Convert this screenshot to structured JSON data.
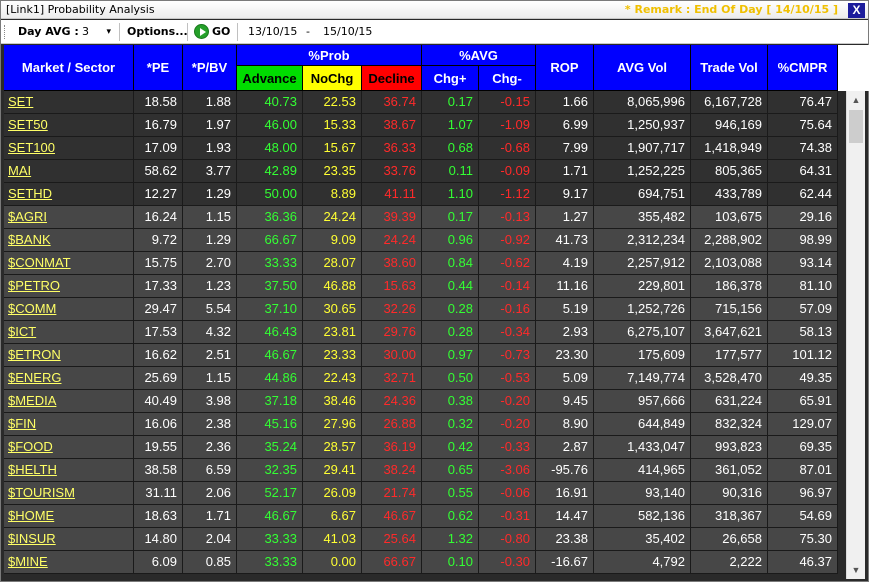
{
  "window": {
    "title": "[Link1] Probability Analysis",
    "remark": "* Remark : End Of Day [ 14/10/15 ]",
    "close": "X"
  },
  "toolbar": {
    "day_avg_label": "Day AVG :",
    "day_avg_value": "3",
    "options_label": "Options...",
    "go_label": "GO",
    "date_from": "13/10/15",
    "date_sep": "-",
    "date_to": "15/10/15"
  },
  "header": {
    "market": "Market / Sector",
    "pe": "*PE",
    "pbv": "*P/BV",
    "prob": "%Prob",
    "advance": "Advance",
    "nochg": "NoChg",
    "decline": "Decline",
    "avg": "%AVG",
    "chg_plus": "Chg+",
    "chg_minus": "Chg-",
    "rop": "ROP",
    "avg_vol": "AVG Vol",
    "trade_vol": "Trade Vol",
    "cmpr": "%CMPR"
  },
  "rows": [
    {
      "name": "SET",
      "pe": "18.58",
      "pbv": "1.88",
      "adv": "40.73",
      "noc": "22.53",
      "dec": "36.74",
      "chgp": "0.17",
      "chgm": "-0.15",
      "rop": "1.66",
      "avgvol": "8,065,996",
      "tradevol": "6,167,728",
      "cmpr": "76.47",
      "kind": "index"
    },
    {
      "name": "SET50",
      "pe": "16.79",
      "pbv": "1.97",
      "adv": "46.00",
      "noc": "15.33",
      "dec": "38.67",
      "chgp": "1.07",
      "chgm": "-1.09",
      "rop": "6.99",
      "avgvol": "1,250,937",
      "tradevol": "946,169",
      "cmpr": "75.64",
      "kind": "index"
    },
    {
      "name": "SET100",
      "pe": "17.09",
      "pbv": "1.93",
      "adv": "48.00",
      "noc": "15.67",
      "dec": "36.33",
      "chgp": "0.68",
      "chgm": "-0.68",
      "rop": "7.99",
      "avgvol": "1,907,717",
      "tradevol": "1,418,949",
      "cmpr": "74.38",
      "kind": "index"
    },
    {
      "name": "MAI",
      "pe": "58.62",
      "pbv": "3.77",
      "adv": "42.89",
      "noc": "23.35",
      "dec": "33.76",
      "chgp": "0.11",
      "chgm": "-0.09",
      "rop": "1.71",
      "avgvol": "1,252,225",
      "tradevol": "805,365",
      "cmpr": "64.31",
      "kind": "index"
    },
    {
      "name": "SETHD",
      "pe": "12.27",
      "pbv": "1.29",
      "adv": "50.00",
      "noc": "8.89",
      "dec": "41.11",
      "chgp": "1.10",
      "chgm": "-1.12",
      "rop": "9.17",
      "avgvol": "694,751",
      "tradevol": "433,789",
      "cmpr": "62.44",
      "kind": "index"
    },
    {
      "name": "$AGRI",
      "pe": "16.24",
      "pbv": "1.15",
      "adv": "36.36",
      "noc": "24.24",
      "dec": "39.39",
      "chgp": "0.17",
      "chgm": "-0.13",
      "rop": "1.27",
      "avgvol": "355,482",
      "tradevol": "103,675",
      "cmpr": "29.16",
      "kind": "sector"
    },
    {
      "name": "$BANK",
      "pe": "9.72",
      "pbv": "1.29",
      "adv": "66.67",
      "noc": "9.09",
      "dec": "24.24",
      "chgp": "0.96",
      "chgm": "-0.92",
      "rop": "41.73",
      "avgvol": "2,312,234",
      "tradevol": "2,288,902",
      "cmpr": "98.99",
      "kind": "sector"
    },
    {
      "name": "$CONMAT",
      "pe": "15.75",
      "pbv": "2.70",
      "adv": "33.33",
      "noc": "28.07",
      "dec": "38.60",
      "chgp": "0.84",
      "chgm": "-0.62",
      "rop": "4.19",
      "avgvol": "2,257,912",
      "tradevol": "2,103,088",
      "cmpr": "93.14",
      "kind": "sector"
    },
    {
      "name": "$PETRO",
      "pe": "17.33",
      "pbv": "1.23",
      "adv": "37.50",
      "noc": "46.88",
      "dec": "15.63",
      "chgp": "0.44",
      "chgm": "-0.14",
      "rop": "11.16",
      "avgvol": "229,801",
      "tradevol": "186,378",
      "cmpr": "81.10",
      "kind": "sector"
    },
    {
      "name": "$COMM",
      "pe": "29.47",
      "pbv": "5.54",
      "adv": "37.10",
      "noc": "30.65",
      "dec": "32.26",
      "chgp": "0.28",
      "chgm": "-0.16",
      "rop": "5.19",
      "avgvol": "1,252,726",
      "tradevol": "715,156",
      "cmpr": "57.09",
      "kind": "sector"
    },
    {
      "name": "$ICT",
      "pe": "17.53",
      "pbv": "4.32",
      "adv": "46.43",
      "noc": "23.81",
      "dec": "29.76",
      "chgp": "0.28",
      "chgm": "-0.34",
      "rop": "2.93",
      "avgvol": "6,275,107",
      "tradevol": "3,647,621",
      "cmpr": "58.13",
      "kind": "sector"
    },
    {
      "name": "$ETRON",
      "pe": "16.62",
      "pbv": "2.51",
      "adv": "46.67",
      "noc": "23.33",
      "dec": "30.00",
      "chgp": "0.97",
      "chgm": "-0.73",
      "rop": "23.30",
      "avgvol": "175,609",
      "tradevol": "177,577",
      "cmpr": "101.12",
      "kind": "sector"
    },
    {
      "name": "$ENERG",
      "pe": "25.69",
      "pbv": "1.15",
      "adv": "44.86",
      "noc": "22.43",
      "dec": "32.71",
      "chgp": "0.50",
      "chgm": "-0.53",
      "rop": "5.09",
      "avgvol": "7,149,774",
      "tradevol": "3,528,470",
      "cmpr": "49.35",
      "kind": "sector"
    },
    {
      "name": "$MEDIA",
      "pe": "40.49",
      "pbv": "3.98",
      "adv": "37.18",
      "noc": "38.46",
      "dec": "24.36",
      "chgp": "0.38",
      "chgm": "-0.20",
      "rop": "9.45",
      "avgvol": "957,666",
      "tradevol": "631,224",
      "cmpr": "65.91",
      "kind": "sector"
    },
    {
      "name": "$FIN",
      "pe": "16.06",
      "pbv": "2.38",
      "adv": "45.16",
      "noc": "27.96",
      "dec": "26.88",
      "chgp": "0.32",
      "chgm": "-0.20",
      "rop": "8.90",
      "avgvol": "644,849",
      "tradevol": "832,324",
      "cmpr": "129.07",
      "kind": "sector"
    },
    {
      "name": "$FOOD",
      "pe": "19.55",
      "pbv": "2.36",
      "adv": "35.24",
      "noc": "28.57",
      "dec": "36.19",
      "chgp": "0.42",
      "chgm": "-0.33",
      "rop": "2.87",
      "avgvol": "1,433,047",
      "tradevol": "993,823",
      "cmpr": "69.35",
      "kind": "sector"
    },
    {
      "name": "$HELTH",
      "pe": "38.58",
      "pbv": "6.59",
      "adv": "32.35",
      "noc": "29.41",
      "dec": "38.24",
      "chgp": "0.65",
      "chgm": "-3.06",
      "rop": "-95.76",
      "avgvol": "414,965",
      "tradevol": "361,052",
      "cmpr": "87.01",
      "kind": "sector"
    },
    {
      "name": "$TOURISM",
      "pe": "31.11",
      "pbv": "2.06",
      "adv": "52.17",
      "noc": "26.09",
      "dec": "21.74",
      "chgp": "0.55",
      "chgm": "-0.06",
      "rop": "16.91",
      "avgvol": "93,140",
      "tradevol": "90,316",
      "cmpr": "96.97",
      "kind": "sector"
    },
    {
      "name": "$HOME",
      "pe": "18.63",
      "pbv": "1.71",
      "adv": "46.67",
      "noc": "6.67",
      "dec": "46.67",
      "chgp": "0.62",
      "chgm": "-0.31",
      "rop": "14.47",
      "avgvol": "582,136",
      "tradevol": "318,367",
      "cmpr": "54.69",
      "kind": "sector"
    },
    {
      "name": "$INSUR",
      "pe": "14.80",
      "pbv": "2.04",
      "adv": "33.33",
      "noc": "41.03",
      "dec": "25.64",
      "chgp": "1.32",
      "chgm": "-0.80",
      "rop": "23.38",
      "avgvol": "35,402",
      "tradevol": "26,658",
      "cmpr": "75.30",
      "kind": "sector"
    },
    {
      "name": "$MINE",
      "pe": "6.09",
      "pbv": "0.85",
      "adv": "33.33",
      "noc": "0.00",
      "dec": "66.67",
      "chgp": "0.10",
      "chgm": "-0.30",
      "rop": "-16.67",
      "avgvol": "4,792",
      "tradevol": "2,222",
      "cmpr": "46.37",
      "kind": "sector"
    }
  ],
  "scrollbar": {
    "up_icon": "chevron-up-icon",
    "down_icon": "chevron-down-icon"
  }
}
